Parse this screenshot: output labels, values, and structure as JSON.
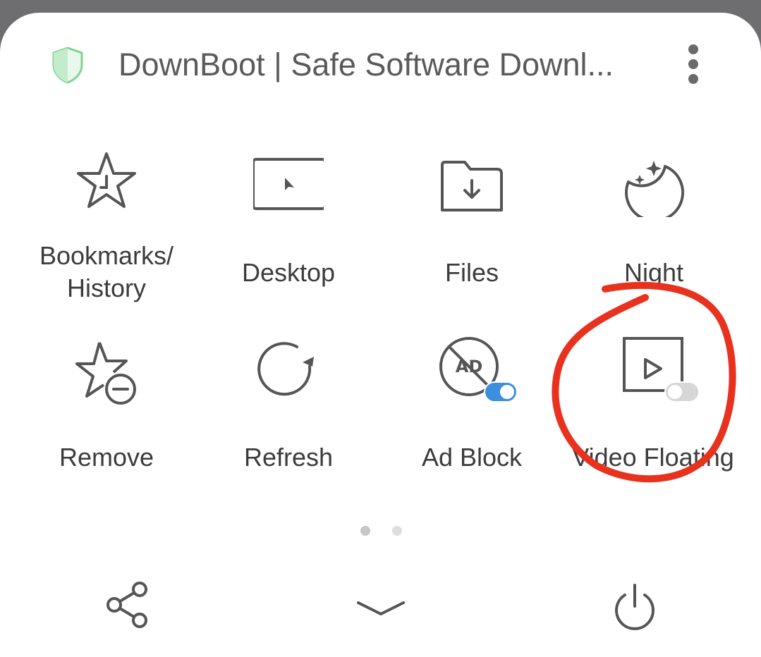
{
  "header": {
    "title": "DownBoot | Safe Software Downl...",
    "shield_icon": "shield-icon",
    "more_icon": "more-vertical-icon"
  },
  "menu": {
    "items": [
      {
        "label": "Bookmarks/\nHistory",
        "icon": "bookmark-history-icon"
      },
      {
        "label": "Desktop",
        "icon": "desktop-icon"
      },
      {
        "label": "Files",
        "icon": "files-download-icon"
      },
      {
        "label": "Night",
        "icon": "night-moon-icon"
      },
      {
        "label": "Remove",
        "icon": "remove-bookmark-icon"
      },
      {
        "label": "Refresh",
        "icon": "refresh-icon"
      },
      {
        "label": "Ad Block",
        "icon": "ad-block-icon",
        "toggle_on": true
      },
      {
        "label": "Video Floating",
        "icon": "video-floating-icon",
        "toggle_on": false
      }
    ]
  },
  "pager": {
    "pages": 2,
    "current": 1
  },
  "bottom_bar": {
    "share_icon": "share-icon",
    "collapse_icon": "chevron-down-icon",
    "power_icon": "power-icon"
  },
  "colors": {
    "text": "#3c3c3c",
    "icon": "#555555",
    "accent_toggle": "#3b8fdc",
    "annotation": "#e8321e",
    "shield": "#7fd48f"
  }
}
